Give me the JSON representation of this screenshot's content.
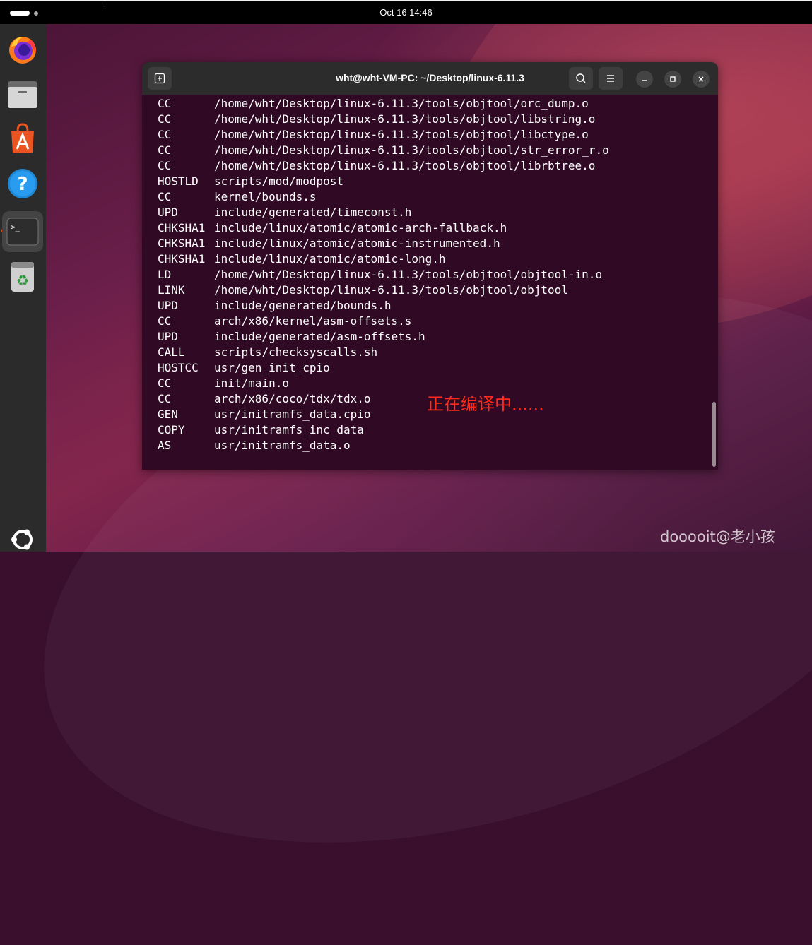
{
  "topbar": {
    "clock": "Oct 16  14:46"
  },
  "dock": {
    "items": [
      {
        "name": "firefox-icon"
      },
      {
        "name": "files-icon"
      },
      {
        "name": "app-center-icon"
      },
      {
        "name": "help-icon"
      },
      {
        "name": "terminal-icon",
        "active": true
      },
      {
        "name": "trash-icon"
      }
    ],
    "show_apps": "ubuntu-logo-icon"
  },
  "terminal": {
    "title": "wht@wht-VM-PC: ~/Desktop/linux-6.11.3",
    "lines": [
      {
        "cmd": "CC",
        "path": "/home/wht/Desktop/linux-6.11.3/tools/objtool/orc_dump.o"
      },
      {
        "cmd": "CC",
        "path": "/home/wht/Desktop/linux-6.11.3/tools/objtool/libstring.o"
      },
      {
        "cmd": "CC",
        "path": "/home/wht/Desktop/linux-6.11.3/tools/objtool/libctype.o"
      },
      {
        "cmd": "CC",
        "path": "/home/wht/Desktop/linux-6.11.3/tools/objtool/str_error_r.o"
      },
      {
        "cmd": "CC",
        "path": "/home/wht/Desktop/linux-6.11.3/tools/objtool/librbtree.o"
      },
      {
        "cmd": "HOSTLD",
        "path": "scripts/mod/modpost"
      },
      {
        "cmd": "CC",
        "path": "kernel/bounds.s"
      },
      {
        "cmd": "UPD",
        "path": "include/generated/timeconst.h"
      },
      {
        "cmd": "CHKSHA1",
        "path": "include/linux/atomic/atomic-arch-fallback.h"
      },
      {
        "cmd": "CHKSHA1",
        "path": "include/linux/atomic/atomic-instrumented.h"
      },
      {
        "cmd": "CHKSHA1",
        "path": "include/linux/atomic/atomic-long.h"
      },
      {
        "cmd": "LD",
        "path": "/home/wht/Desktop/linux-6.11.3/tools/objtool/objtool-in.o"
      },
      {
        "cmd": "LINK",
        "path": "/home/wht/Desktop/linux-6.11.3/tools/objtool/objtool"
      },
      {
        "cmd": "UPD",
        "path": "include/generated/bounds.h"
      },
      {
        "cmd": "CC",
        "path": "arch/x86/kernel/asm-offsets.s"
      },
      {
        "cmd": "UPD",
        "path": "include/generated/asm-offsets.h"
      },
      {
        "cmd": "CALL",
        "path": "scripts/checksyscalls.sh"
      },
      {
        "cmd": "HOSTCC",
        "path": "usr/gen_init_cpio"
      },
      {
        "cmd": "CC",
        "path": "init/main.o"
      },
      {
        "cmd": "CC",
        "path": "arch/x86/coco/tdx/tdx.o"
      },
      {
        "cmd": "GEN",
        "path": "usr/initramfs_data.cpio"
      },
      {
        "cmd": "COPY",
        "path": "usr/initramfs_inc_data"
      },
      {
        "cmd": "AS",
        "path": "usr/initramfs_data.o"
      }
    ]
  },
  "annotation": "正在编译中......",
  "watermark": "dooooit@老小孩",
  "colors": {
    "terminal_bg": "#300a24",
    "titlebar_bg": "#2c2c2c",
    "annotation": "#ff2a1a",
    "accent": "#e95420"
  }
}
